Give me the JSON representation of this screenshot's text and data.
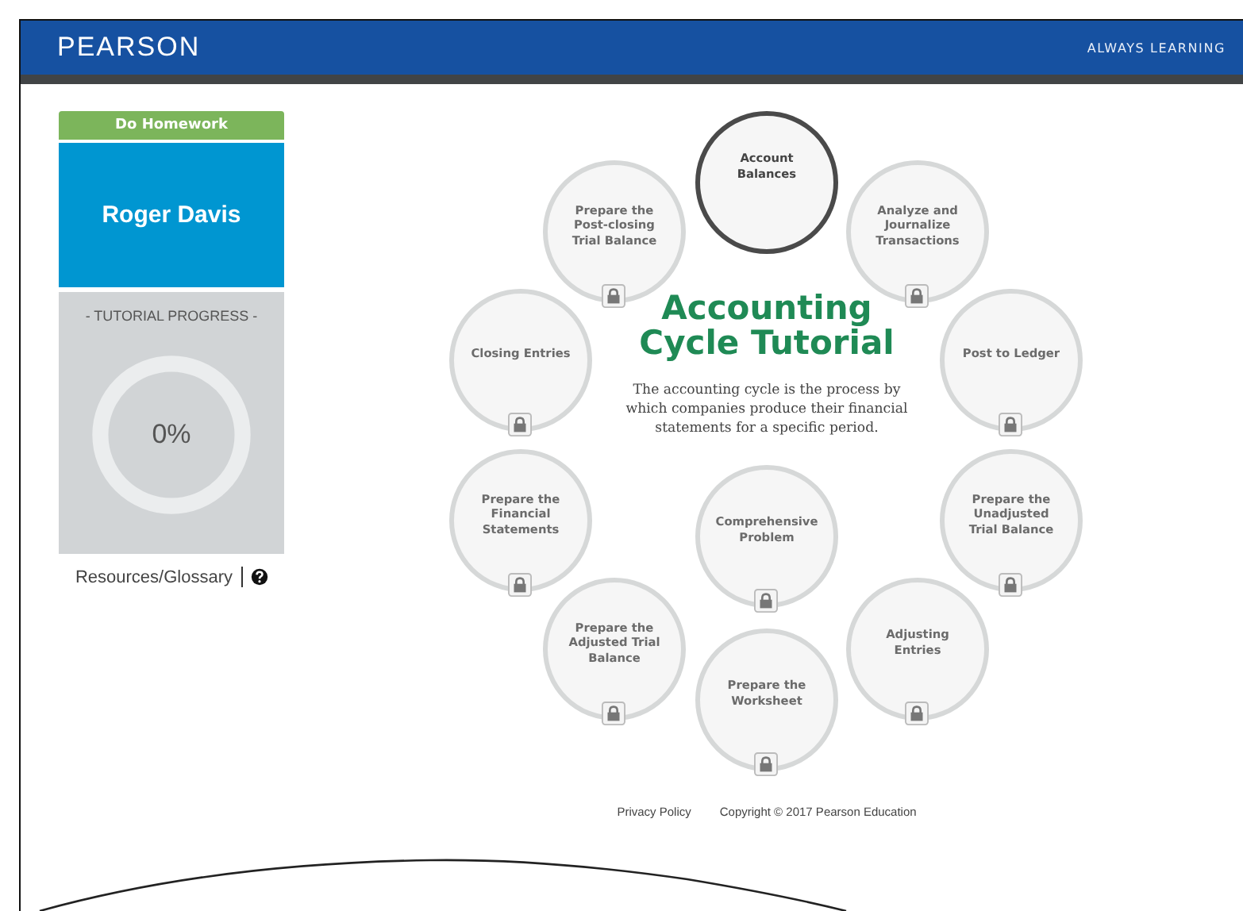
{
  "header": {
    "logo": "PEARSON",
    "tagline": "ALWAYS LEARNING"
  },
  "sidebar": {
    "homework_button": "Do Homework",
    "student_name": "Roger Davis",
    "progress_title": "- TUTORIAL PROGRESS -",
    "progress": {
      "reading": "0%"
    },
    "resources_link": "Resources/Glossary"
  },
  "tutorial": {
    "title_lines": [
      "Accounting",
      "Cycle Tutorial"
    ],
    "description": "The accounting cycle is the process by which companies produce their financial statements for a specific period.",
    "steps": [
      {
        "label": "Account Balances",
        "selected": true,
        "locked": false
      },
      {
        "label": "Prepare the Post-closing Trial Balance",
        "selected": false,
        "locked": true
      },
      {
        "label": "Analyze and Journalize Transactions",
        "selected": false,
        "locked": true
      },
      {
        "label": "Closing Entries",
        "selected": false,
        "locked": true
      },
      {
        "label": "Post to Ledger",
        "selected": false,
        "locked": true
      },
      {
        "label": "Prepare the Financial Statements",
        "selected": false,
        "locked": true
      },
      {
        "label": "Prepare the Unadjusted Trial Balance",
        "selected": false,
        "locked": true
      },
      {
        "label": "Comprehensive Problem",
        "selected": false,
        "locked": true
      },
      {
        "label": "Prepare the Adjusted Trial Balance",
        "selected": false,
        "locked": true
      },
      {
        "label": "Adjusting Entries",
        "selected": false,
        "locked": true
      },
      {
        "label": "Prepare the Worksheet",
        "selected": false,
        "locked": true
      }
    ]
  },
  "footer": {
    "links": [
      "Privacy Policy",
      "Copyright © 2017 Pearson Education"
    ]
  }
}
